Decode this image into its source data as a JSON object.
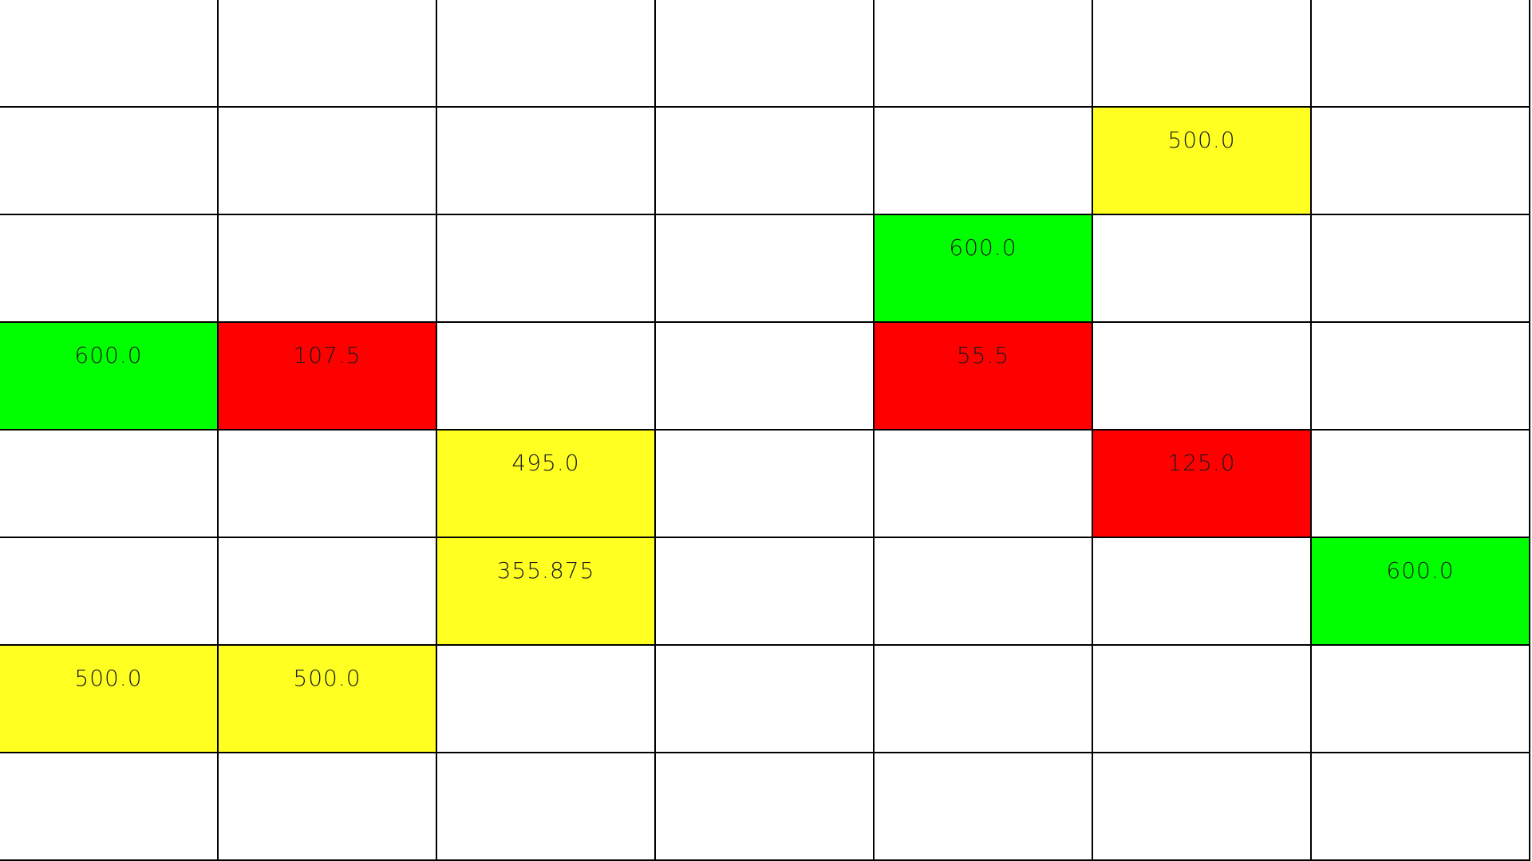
{
  "colors": {
    "empty": "#ffffff",
    "green": "#00ff00",
    "yellow": "#ffff22",
    "red": "#ff0000",
    "gridline": "#000000"
  },
  "grid": {
    "rows": [
      [
        null,
        null,
        null,
        null,
        null,
        null,
        null
      ],
      [
        null,
        null,
        null,
        null,
        null,
        {
          "value": "500.0",
          "color": "yellow"
        },
        null
      ],
      [
        null,
        null,
        null,
        null,
        {
          "value": "600.0",
          "color": "green"
        },
        null,
        null
      ],
      [
        {
          "value": "600.0",
          "color": "green"
        },
        {
          "value": "107.5",
          "color": "red"
        },
        null,
        null,
        {
          "value": "55.5",
          "color": "red"
        },
        null,
        null
      ],
      [
        null,
        null,
        {
          "value": "495.0",
          "color": "yellow"
        },
        null,
        null,
        {
          "value": "125.0",
          "color": "red"
        },
        null
      ],
      [
        null,
        null,
        {
          "value": "355.875",
          "color": "yellow"
        },
        null,
        null,
        null,
        {
          "value": "600.0",
          "color": "green"
        }
      ],
      [
        {
          "value": "500.0",
          "color": "yellow"
        },
        {
          "value": "500.0",
          "color": "yellow"
        },
        null,
        null,
        null,
        null,
        null
      ],
      [
        null,
        null,
        null,
        null,
        null,
        null,
        null
      ]
    ]
  }
}
